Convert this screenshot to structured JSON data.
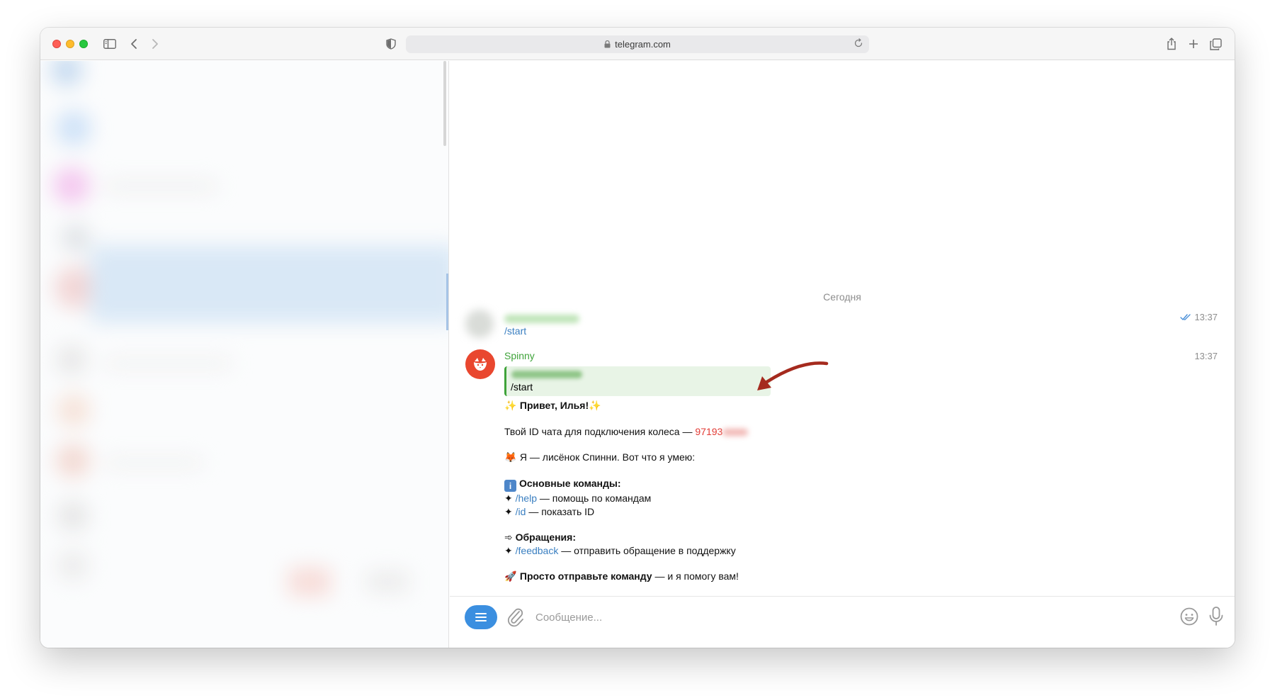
{
  "browser": {
    "url": "telegram.com"
  },
  "chat": {
    "date_separator": "Сегодня",
    "messages": [
      {
        "text": "/start",
        "time": "13:37"
      },
      {
        "sender": "Spinny",
        "time": "13:37",
        "reply_text": "/start",
        "greeting": "Привет, Илья!",
        "id_line_prefix": "Твой ID чата для подключения колеса —",
        "id_value": "97193",
        "intro": "Я — лисёнок Спинни. Вот что я умею:",
        "section_main": "Основные команды:",
        "cmd_help": "/help",
        "cmd_help_desc": "— помощь по командам",
        "cmd_id": "/id",
        "cmd_id_desc": "— показать ID",
        "section_feedback": "Обращения:",
        "cmd_feedback": "/feedback",
        "cmd_feedback_desc": "— отправить обращение в поддержку",
        "outro_bold": "Просто отправьте команду",
        "outro_rest": "— и я помогу вам!"
      }
    ]
  },
  "composer": {
    "placeholder": "Сообщение..."
  },
  "colors": {
    "accent": "#3b8fe0",
    "bot_name": "#3fa33a",
    "id_highlight": "#e23b35",
    "annotation_arrow": "#a52a1e"
  }
}
